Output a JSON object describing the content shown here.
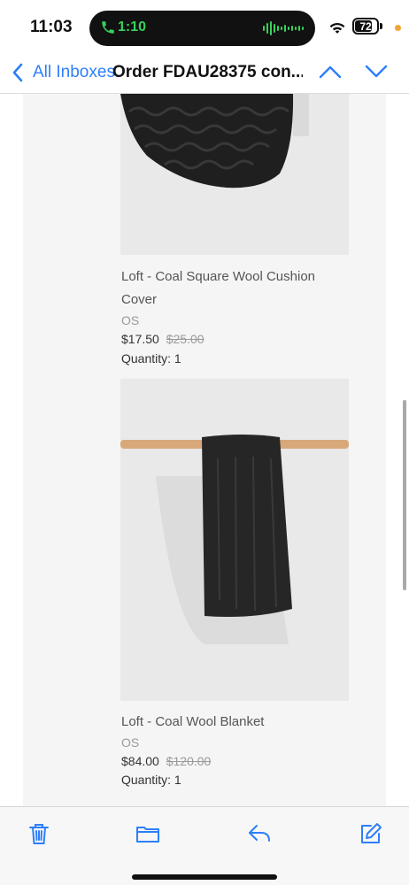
{
  "status_bar": {
    "time": "11:03",
    "call_timer": "1:10",
    "battery_level": "72",
    "battery_fraction": 0.72,
    "icons": [
      "phone-icon",
      "waveform-icon",
      "wifi-icon",
      "battery-icon"
    ],
    "colors": {
      "call_green": "#37d15c",
      "privacy_dot": "#f3a437"
    }
  },
  "nav": {
    "back_label": "All Inboxes",
    "title": "Order FDAU28375 con...",
    "accent": "#2d7ff9"
  },
  "products": [
    {
      "name": "Loft - Coal Square Wool Cushion Cover",
      "variant": "OS",
      "price": "$17.50",
      "original_price": "$25.00",
      "quantity": "Quantity: 1"
    },
    {
      "name": "Loft - Coal Wool Blanket",
      "variant": "OS",
      "price": "$84.00",
      "original_price": "$120.00",
      "quantity": "Quantity: 1"
    }
  ],
  "toolbar": {
    "items": [
      "trash-icon",
      "folder-icon",
      "reply-icon",
      "compose-icon"
    ]
  }
}
